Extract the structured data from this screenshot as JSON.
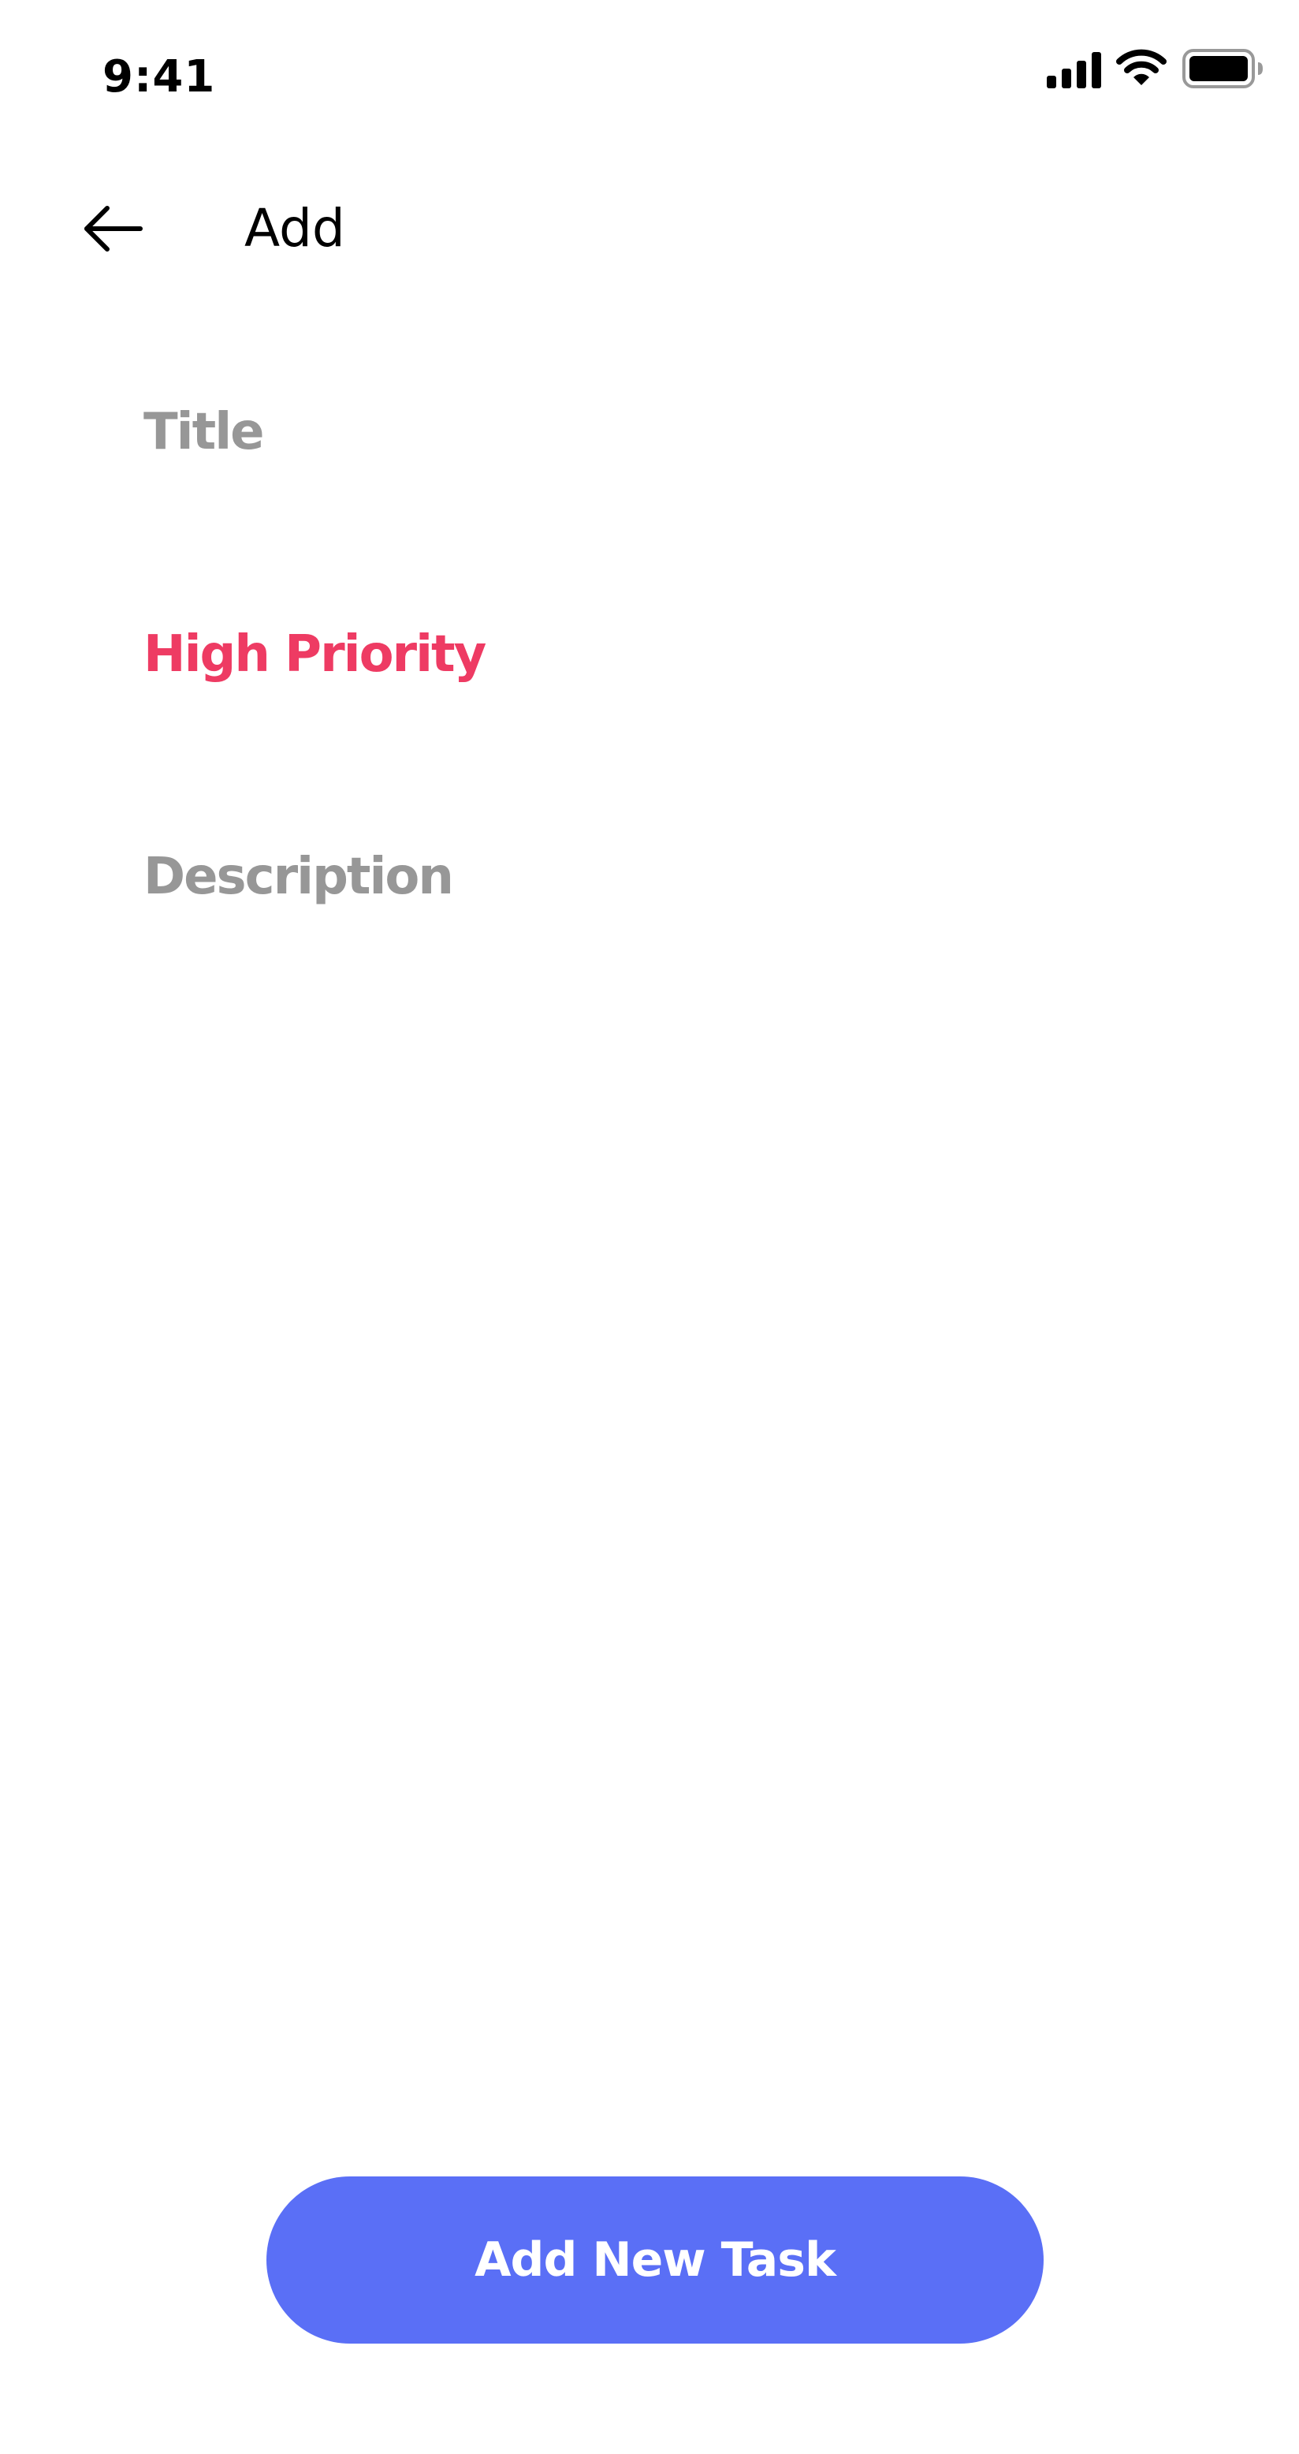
{
  "status_bar": {
    "time": "9:41",
    "icons": [
      "signal-icon",
      "wifi-icon",
      "battery-icon"
    ]
  },
  "header": {
    "back_icon": "arrow-left-icon",
    "title": "Add"
  },
  "form": {
    "title_placeholder": "Title",
    "priority_label": "High Priority",
    "description_placeholder": "Description"
  },
  "actions": {
    "add_button_label": "Add New Task"
  },
  "colors": {
    "accent": "#5A6FF6",
    "priority_high": "#EE3B63",
    "placeholder": "#979797",
    "background": "#FFFFFF",
    "text": "#000000"
  }
}
